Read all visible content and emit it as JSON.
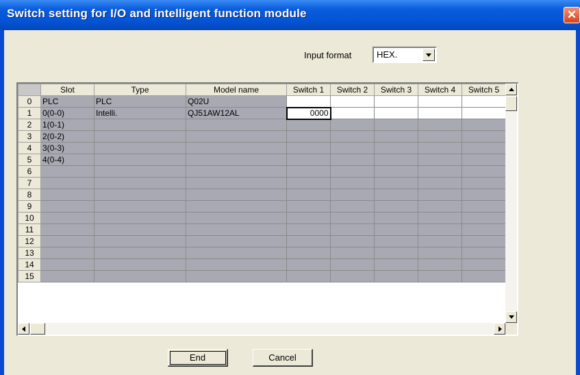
{
  "window": {
    "title": "Switch setting for I/O and intelligent function module",
    "close_glyph": "✕"
  },
  "input_format": {
    "label": "Input format",
    "value": "HEX."
  },
  "grid": {
    "columns": [
      "Slot",
      "Type",
      "Model name",
      "Switch 1",
      "Switch 2",
      "Switch 3",
      "Switch 4",
      "Switch 5"
    ],
    "rows": [
      {
        "num": "0",
        "slot": "PLC",
        "type": "PLC",
        "model": "Q02U",
        "switches": [
          "",
          "",
          "",
          "",
          ""
        ]
      },
      {
        "num": "1",
        "slot": "0(0-0)",
        "type": "Intelli.",
        "model": "QJ51AW12AL",
        "switches": [
          "0000",
          "",
          "",
          "",
          ""
        ]
      },
      {
        "num": "2",
        "slot": "1(0-1)",
        "type": "",
        "model": "",
        "switches": [
          "",
          "",
          "",
          "",
          ""
        ]
      },
      {
        "num": "3",
        "slot": "2(0-2)",
        "type": "",
        "model": "",
        "switches": [
          "",
          "",
          "",
          "",
          ""
        ]
      },
      {
        "num": "4",
        "slot": "3(0-3)",
        "type": "",
        "model": "",
        "switches": [
          "",
          "",
          "",
          "",
          ""
        ]
      },
      {
        "num": "5",
        "slot": "4(0-4)",
        "type": "",
        "model": "",
        "switches": [
          "",
          "",
          "",
          "",
          ""
        ]
      },
      {
        "num": "6",
        "slot": "",
        "type": "",
        "model": "",
        "switches": [
          "",
          "",
          "",
          "",
          ""
        ]
      },
      {
        "num": "7",
        "slot": "",
        "type": "",
        "model": "",
        "switches": [
          "",
          "",
          "",
          "",
          ""
        ]
      },
      {
        "num": "8",
        "slot": "",
        "type": "",
        "model": "",
        "switches": [
          "",
          "",
          "",
          "",
          ""
        ]
      },
      {
        "num": "9",
        "slot": "",
        "type": "",
        "model": "",
        "switches": [
          "",
          "",
          "",
          "",
          ""
        ]
      },
      {
        "num": "10",
        "slot": "",
        "type": "",
        "model": "",
        "switches": [
          "",
          "",
          "",
          "",
          ""
        ]
      },
      {
        "num": "11",
        "slot": "",
        "type": "",
        "model": "",
        "switches": [
          "",
          "",
          "",
          "",
          ""
        ]
      },
      {
        "num": "12",
        "slot": "",
        "type": "",
        "model": "",
        "switches": [
          "",
          "",
          "",
          "",
          ""
        ]
      },
      {
        "num": "13",
        "slot": "",
        "type": "",
        "model": "",
        "switches": [
          "",
          "",
          "",
          "",
          ""
        ]
      },
      {
        "num": "14",
        "slot": "",
        "type": "",
        "model": "",
        "switches": [
          "",
          "",
          "",
          "",
          ""
        ]
      },
      {
        "num": "15",
        "slot": "",
        "type": "",
        "model": "",
        "switches": [
          "",
          "",
          "",
          "",
          ""
        ]
      }
    ]
  },
  "buttons": {
    "end": "End",
    "cancel": "Cancel"
  },
  "colors": {
    "titlebar": "#0454d6",
    "window_bg": "#ece9d8",
    "disabled_cell": "#a9a9b3",
    "editable_cell": "#ffffff"
  }
}
